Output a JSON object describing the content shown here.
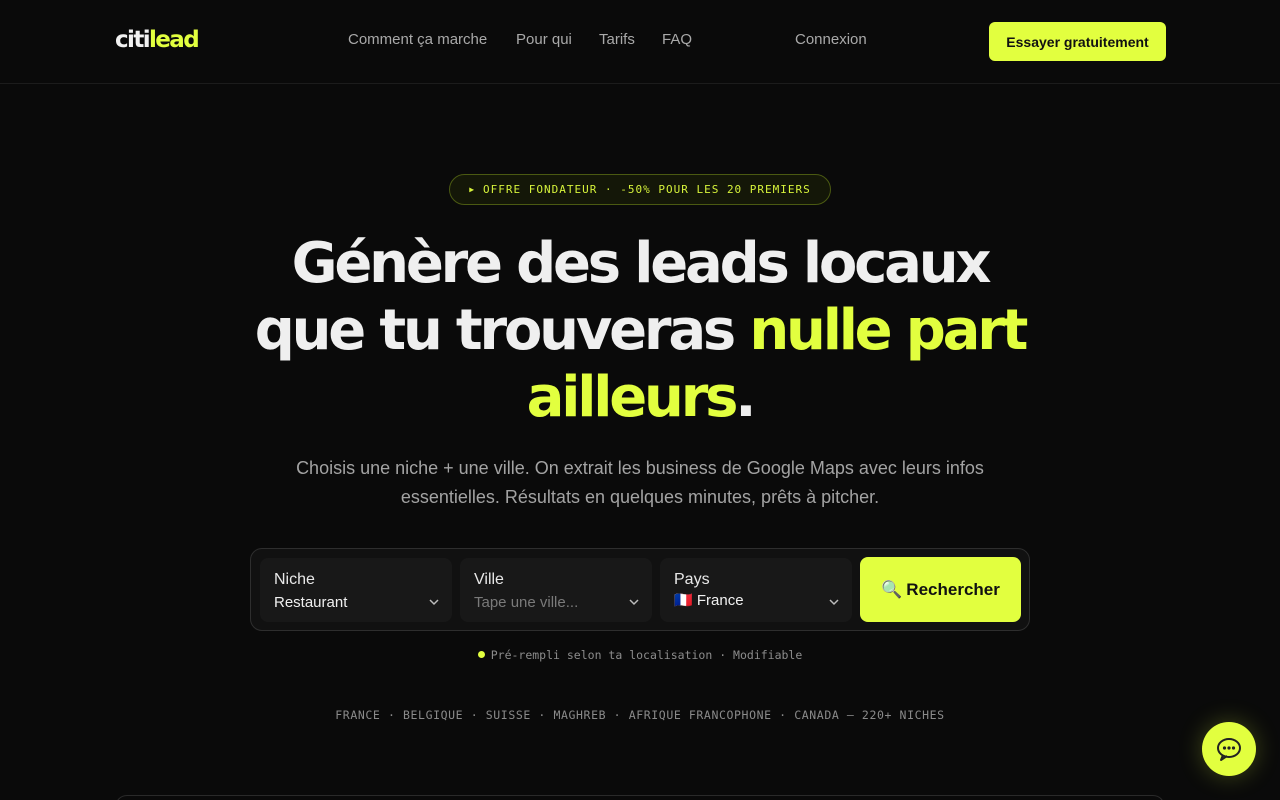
{
  "header": {
    "logo_part1": "citi",
    "logo_part2": "lead",
    "nav": [
      "Comment ça marche",
      "Pour qui",
      "Tarifs",
      "FAQ"
    ],
    "login": "Connexion",
    "cta": "Essayer gratuitement"
  },
  "hero": {
    "badge": "OFFRE FONDATEUR · -50% POUR LES 20 PREMIERS",
    "title_line1": "Génère des leads locaux",
    "title_line2_a": "que tu trouveras ",
    "title_line2_b": "nulle part",
    "title_line3_a": "ailleurs",
    "title_line3_b": ".",
    "subtitle": "Choisis une niche + une ville. On extrait les business de Google Maps avec leurs infos essentielles. Résultats en quelques minutes, prêts à pitcher."
  },
  "search": {
    "niche_label": "Niche",
    "niche_value": "Restaurant",
    "city_label": "Ville",
    "city_placeholder": "Tape une ville...",
    "country_label": "Pays",
    "country_flag": "🇫🇷",
    "country_value": "France",
    "button_icon": "🔍",
    "button_label": "Rechercher"
  },
  "note": "Pré-rempli selon ta localisation · Modifiable",
  "regions": "FRANCE · BELGIQUE · SUISSE · MAGHREB · AFRIQUE FRANCOPHONE · CANADA — 220+ NICHES",
  "colors": {
    "accent": "#e2ff3f",
    "background": "#0a0a0a"
  },
  "icons": {
    "chevron": "chevron-down-icon",
    "chat": "chat-bubble-icon",
    "search": "magnifier-icon"
  }
}
